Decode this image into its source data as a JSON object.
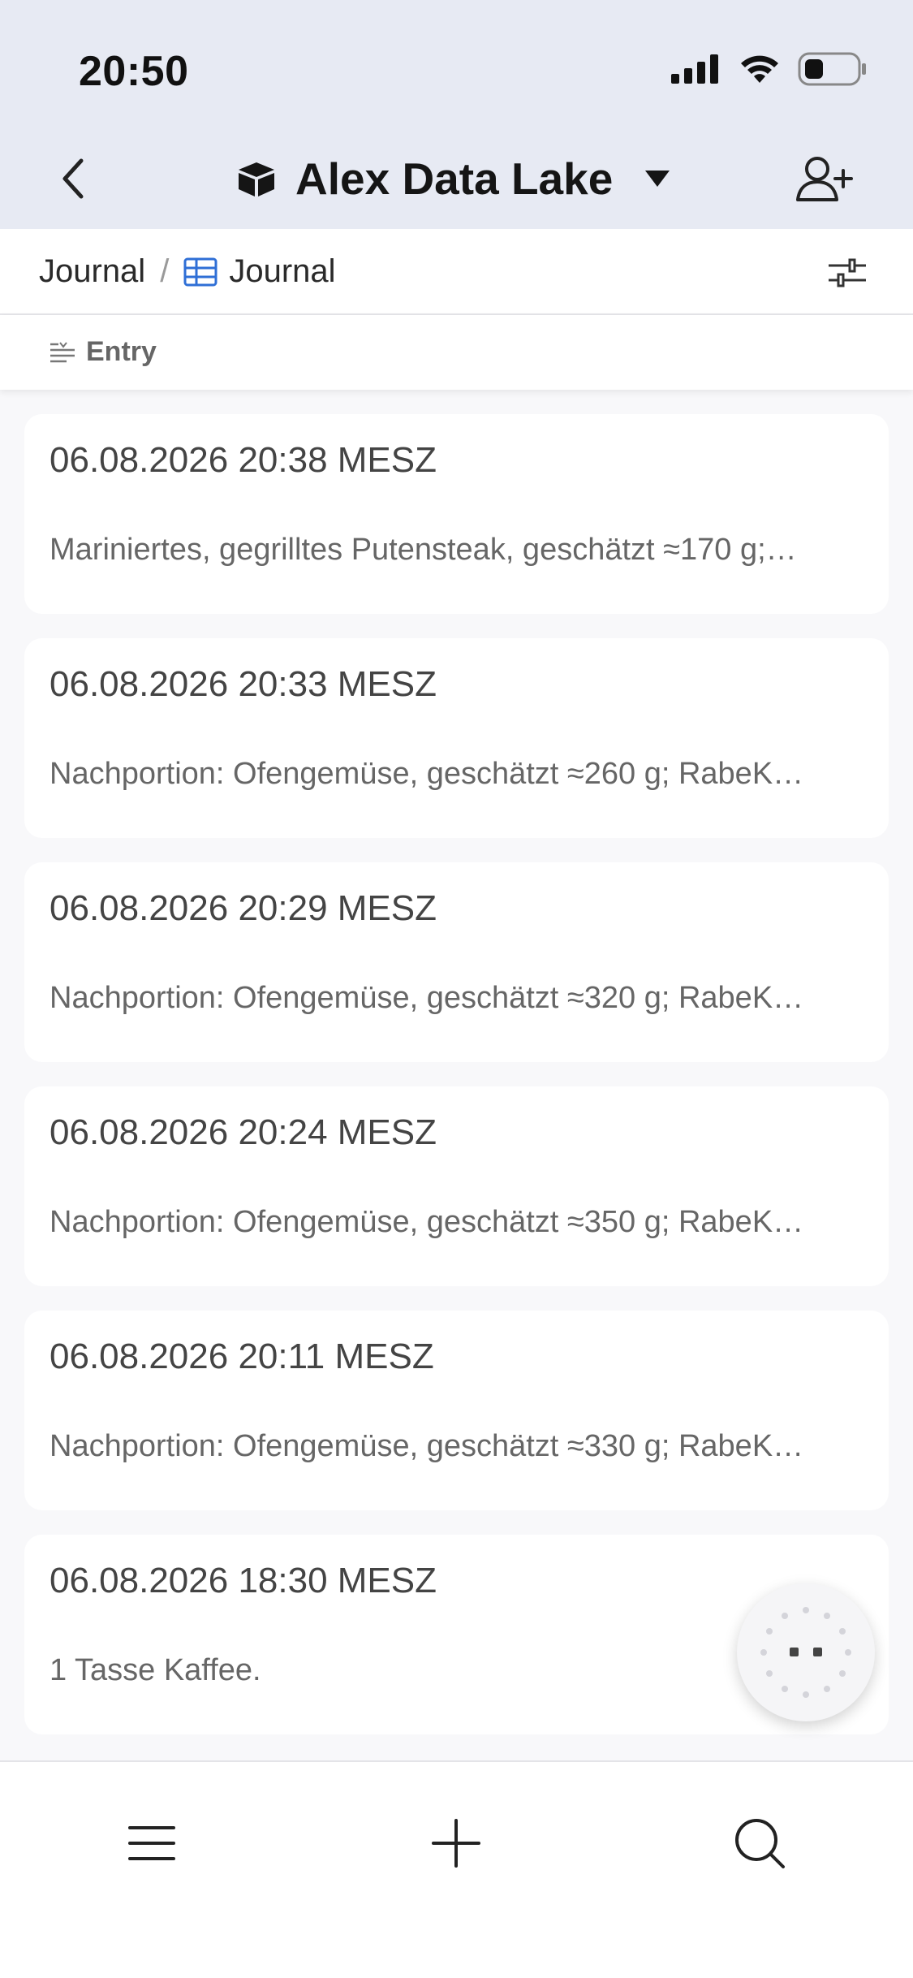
{
  "status_bar": {
    "time": "20:50"
  },
  "header": {
    "title": "Alex Data Lake"
  },
  "breadcrumb": {
    "parent": "Journal",
    "separator": "/",
    "current": "Journal"
  },
  "field": {
    "label": "Entry"
  },
  "entries": [
    {
      "date": "06.08.2026 20:38 MESZ",
      "text": "Mariniertes, gegrilltes Putensteak, geschätzt ≈170 g;…"
    },
    {
      "date": "06.08.2026 20:33 MESZ",
      "text": "Nachportion: Ofengemüse, geschätzt ≈260 g; RabeK…"
    },
    {
      "date": "06.08.2026 20:29 MESZ",
      "text": "Nachportion: Ofengemüse, geschätzt ≈320 g; RabeK…"
    },
    {
      "date": "06.08.2026 20:24 MESZ",
      "text": "Nachportion: Ofengemüse, geschätzt ≈350 g; RabeK…"
    },
    {
      "date": "06.08.2026 20:11 MESZ",
      "text": "Nachportion: Ofengemüse, geschätzt ≈330 g; RabeK…"
    },
    {
      "date": "06.08.2026 18:30 MESZ",
      "text": "1 Tasse Kaffee."
    }
  ],
  "icons": {
    "back": "chevron-left-icon",
    "workspace": "cube-icon",
    "dropdown": "caret-down-icon",
    "add_user": "add-user-icon",
    "table": "table-icon",
    "filter": "sliders-icon",
    "field_type": "text-lines-icon",
    "menu": "menu-icon",
    "add": "plus-icon",
    "search": "search-icon",
    "assistant": "loading-dots-icon"
  },
  "colors": {
    "header_bg": "#e7eaf3",
    "accent": "#2f6fd6",
    "page_bg": "#f8f8fa"
  }
}
